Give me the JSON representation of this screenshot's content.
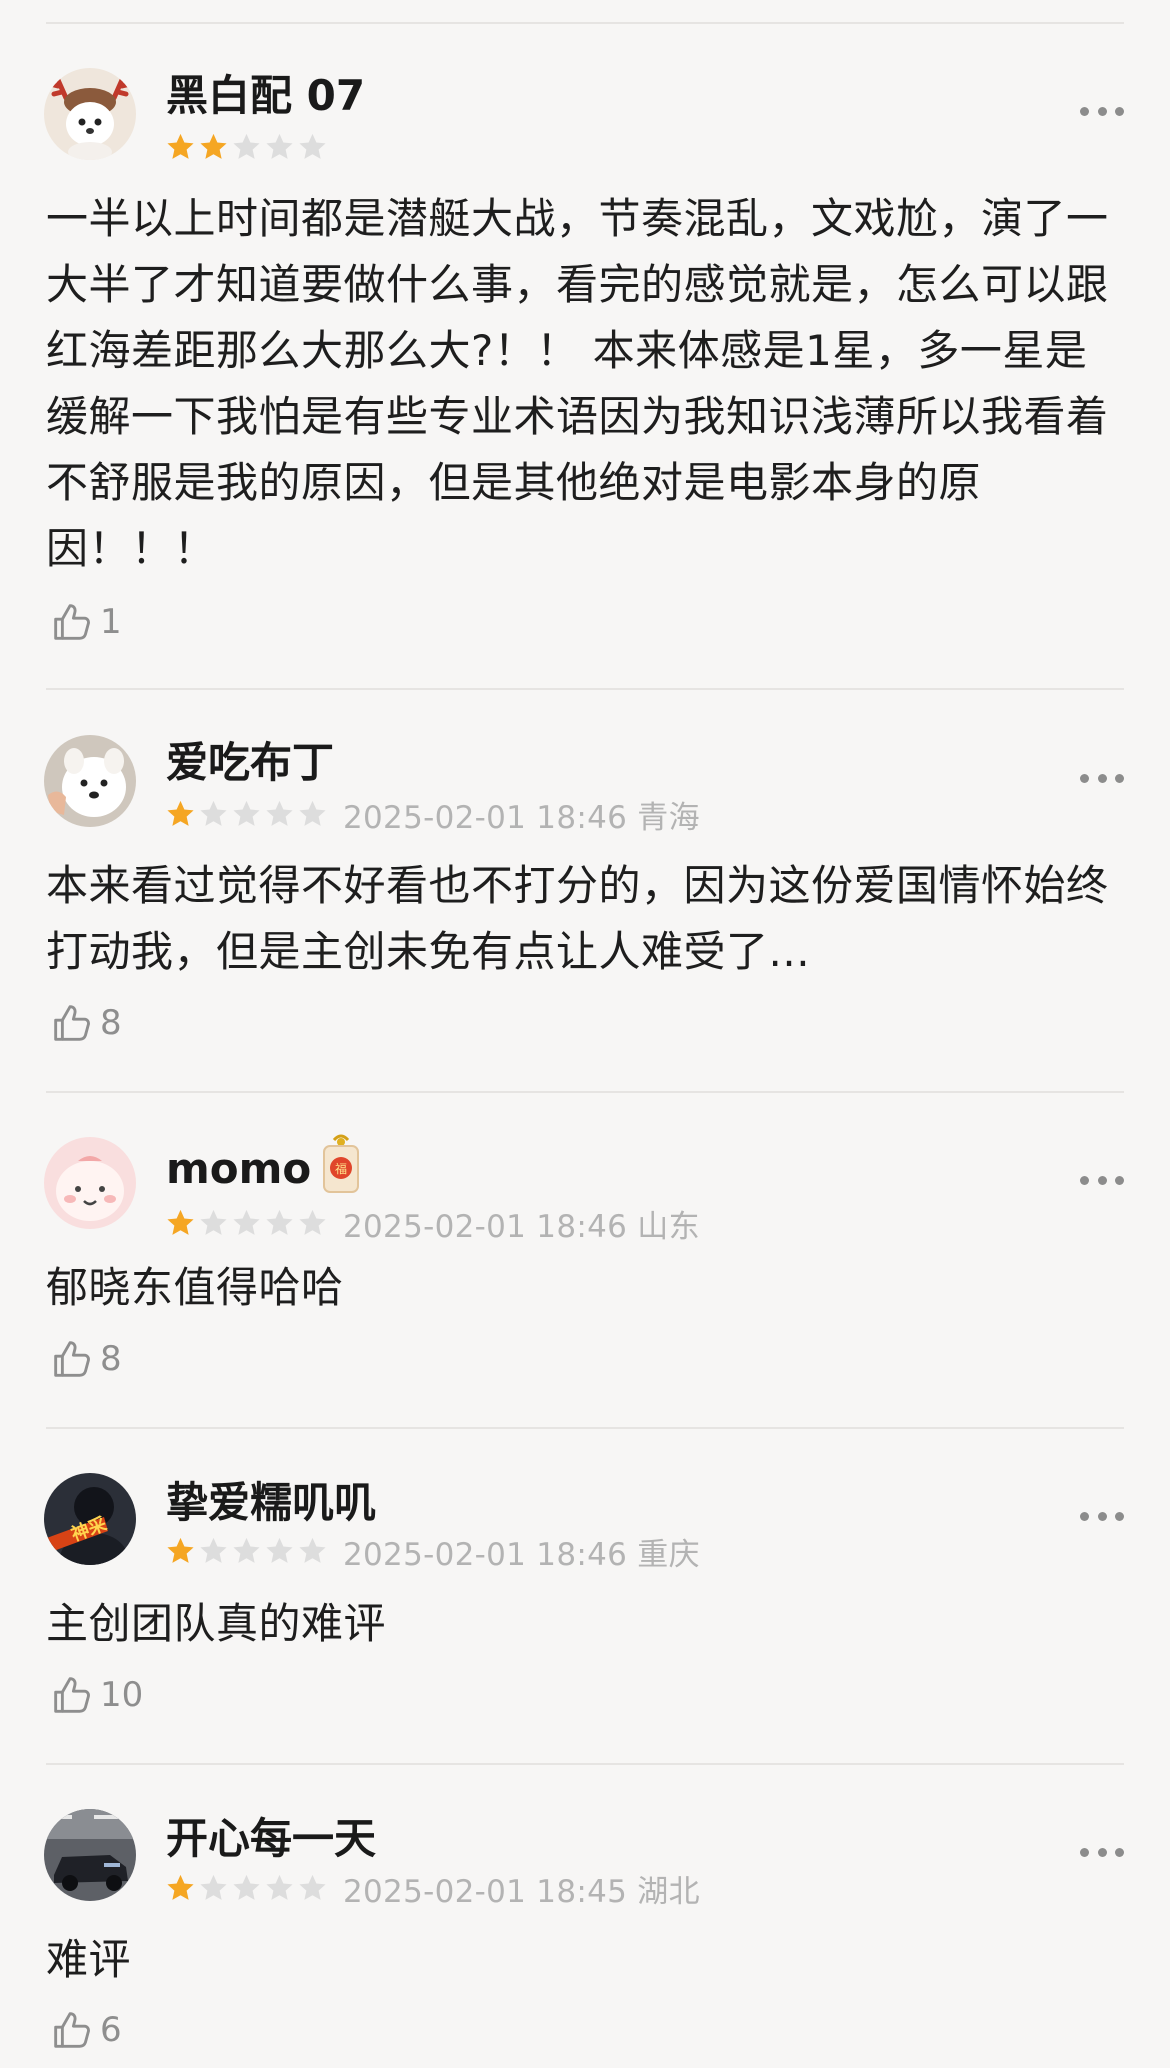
{
  "reviews": [
    {
      "username": "黑白配 07",
      "rating": 2,
      "date_location": "",
      "content": "一半以上时间都是潜艇大战，节奏混乱，文戏尬，演了一大半了才知道要做什么事，看完的感觉就是，怎么可以跟红海差距那么大那么大?！！ 本来体感是1星，多一星是缓解一下我怕是有些专业术语因为我知识浅薄所以我看着不舒服是我的原因，但是其他绝对是电影本身的原因！！！",
      "likes": "1",
      "avatar": "reindeer-puppy-avatar"
    },
    {
      "username": "爱吃布丁",
      "rating": 1,
      "date_location": "2025-02-01 18:46 青海",
      "content": "本来看过觉得不好看也不打分的，因为这份爱国情怀始终打动我，但是主创未免有点让人难受了...",
      "likes": "8",
      "avatar": "white-dog-avatar"
    },
    {
      "username": "momo",
      "rating": 1,
      "date_location": "2025-02-01 18:46 山东",
      "content": "郁晓东值得哈哈",
      "likes": "8",
      "avatar": "pink-cartoon-avatar",
      "badge": "lucky-charm-badge"
    },
    {
      "username": "挚爱糯叽叽",
      "rating": 1,
      "date_location": "2025-02-01 18:46 重庆",
      "content": "主创团队真的难评",
      "likes": "10",
      "avatar": "dark-portrait-avatar",
      "avatar_text": "神采"
    },
    {
      "username": "开心每一天",
      "rating": 1,
      "date_location": "2025-02-01 18:45 湖北",
      "content": "难评",
      "likes": "6",
      "avatar": "car-garage-avatar"
    }
  ],
  "colors": {
    "background": "#f7f6f5",
    "star_filled": "#f5a623",
    "star_empty": "#dddddd",
    "meta_text": "#b3b3b3",
    "divider": "#e6e4e2"
  }
}
